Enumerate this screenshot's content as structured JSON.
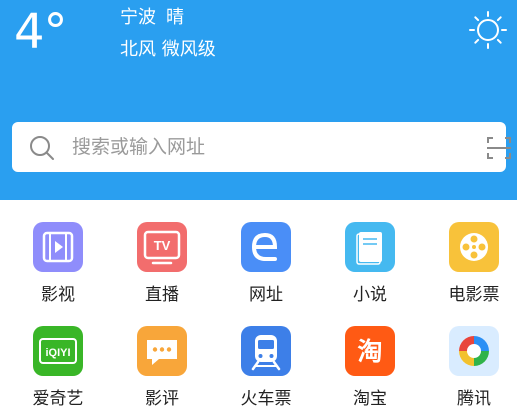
{
  "weather": {
    "temperature": "4°",
    "city": "宁波",
    "condition": "晴",
    "wind": "北风 微风级"
  },
  "search": {
    "placeholder": "搜索或输入网址"
  },
  "shortcuts": [
    {
      "label": "影视",
      "color": "#8f8dfb",
      "icon": "video-icon"
    },
    {
      "label": "直播",
      "color": "#f26d6d",
      "icon": "tv-icon",
      "text": "TV"
    },
    {
      "label": "网址",
      "color": "#4a8ef7",
      "icon": "browser-e-icon"
    },
    {
      "label": "小说",
      "color": "#45b9f0",
      "icon": "book-icon"
    },
    {
      "label": "电影票",
      "color": "#f8c23a",
      "icon": "film-reel-icon"
    },
    {
      "label": "爱奇艺",
      "color": "#39b627",
      "icon": "iqiyi-icon",
      "text": "iQIYI"
    },
    {
      "label": "影评",
      "color": "#f8a63a",
      "icon": "comment-icon"
    },
    {
      "label": "火车票",
      "color": "#3d7fe8",
      "icon": "train-icon"
    },
    {
      "label": "淘宝",
      "color": "#ff5a14",
      "icon": "taobao-icon",
      "text": "淘"
    },
    {
      "label": "腾讯",
      "color": "#d9ecff",
      "icon": "tencent-news-icon"
    }
  ]
}
